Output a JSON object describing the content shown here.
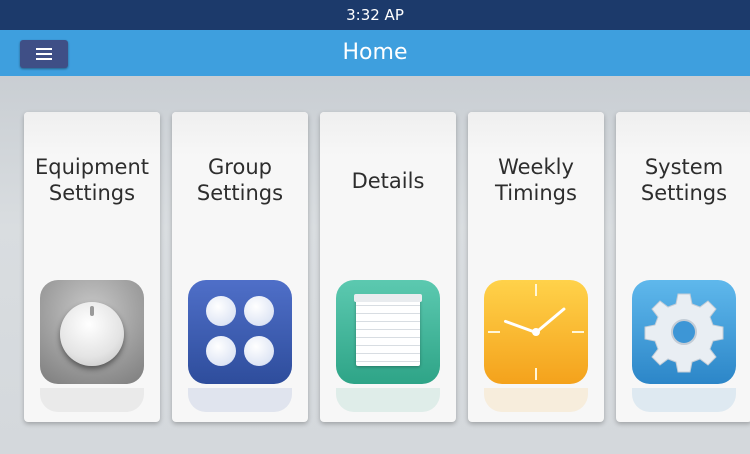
{
  "status_bar": {
    "time": "3:32 AP"
  },
  "header": {
    "title": "Home",
    "menu_icon": "hamburger-menu-icon"
  },
  "tiles": [
    {
      "line1": "Equipment",
      "line2": "Settings",
      "icon": "dial-knob-icon"
    },
    {
      "line1": "Group",
      "line2": "Settings",
      "icon": "four-dots-icon"
    },
    {
      "line1": "Details",
      "line2": "",
      "icon": "notepad-icon"
    },
    {
      "line1": "Weekly",
      "line2": "Timings",
      "icon": "clock-icon"
    },
    {
      "line1": "System",
      "line2": "Settings",
      "icon": "gear-icon"
    }
  ],
  "colors": {
    "status_bar": "#1c3a6b",
    "title_bar": "#3e9fde",
    "menu_button": "#3f4f86",
    "background": "#d4d8dc"
  }
}
